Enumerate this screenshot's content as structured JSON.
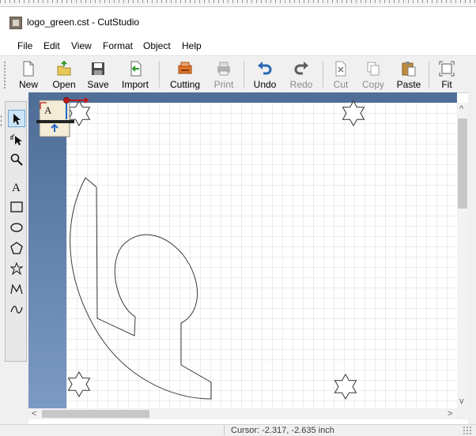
{
  "window": {
    "title": "logo_green.cst - CutStudio"
  },
  "menu": [
    "File",
    "Edit",
    "View",
    "Format",
    "Object",
    "Help"
  ],
  "toolbar": [
    {
      "label": "New",
      "icon": "new-document-icon",
      "enabled": true
    },
    {
      "label": "Open",
      "icon": "open-folder-icon",
      "enabled": true
    },
    {
      "label": "Save",
      "icon": "floppy-disk-icon",
      "enabled": true
    },
    {
      "label": "Import",
      "icon": "import-icon",
      "enabled": true
    },
    {
      "label": "Cutting",
      "icon": "cutter-icon",
      "enabled": true
    },
    {
      "label": "Print",
      "icon": "printer-icon",
      "enabled": false
    },
    {
      "label": "Undo",
      "icon": "undo-icon",
      "enabled": true
    },
    {
      "label": "Redo",
      "icon": "redo-icon",
      "enabled": false
    },
    {
      "label": "Cut",
      "icon": "scissors-icon",
      "enabled": false
    },
    {
      "label": "Copy",
      "icon": "copy-icon",
      "enabled": false
    },
    {
      "label": "Paste",
      "icon": "paste-icon",
      "enabled": true
    },
    {
      "label": "Fit",
      "icon": "fit-icon",
      "enabled": true
    }
  ],
  "tools": [
    {
      "name": "select-tool",
      "icon": "arrow-pointer-icon",
      "selected": true
    },
    {
      "name": "node-edit-tool",
      "icon": "node-edit-icon",
      "selected": false
    },
    {
      "name": "zoom-tool",
      "icon": "magnifier-icon",
      "selected": false
    },
    {
      "name": "text-tool",
      "icon": "text-icon",
      "selected": false
    },
    {
      "name": "rectangle-tool",
      "icon": "rectangle-icon",
      "selected": false
    },
    {
      "name": "ellipse-tool",
      "icon": "ellipse-icon",
      "selected": false
    },
    {
      "name": "polygon-tool",
      "icon": "polygon-icon",
      "selected": false
    },
    {
      "name": "star-tool",
      "icon": "star-icon",
      "selected": false
    },
    {
      "name": "polyline-tool",
      "icon": "polyline-icon",
      "selected": false
    },
    {
      "name": "curve-tool",
      "icon": "curve-icon",
      "selected": false
    }
  ],
  "canvas": {
    "text_tool_marker": "A",
    "scroll_left": "<",
    "scroll_right": ">",
    "scroll_up": "^",
    "scroll_down": "v"
  },
  "status": {
    "cursor": "Cursor: -2.317, -2.635 inch"
  },
  "colors": {
    "canvas_edge": "#4f6f98",
    "grid": "#dadada",
    "selection": "#cce4f7"
  }
}
